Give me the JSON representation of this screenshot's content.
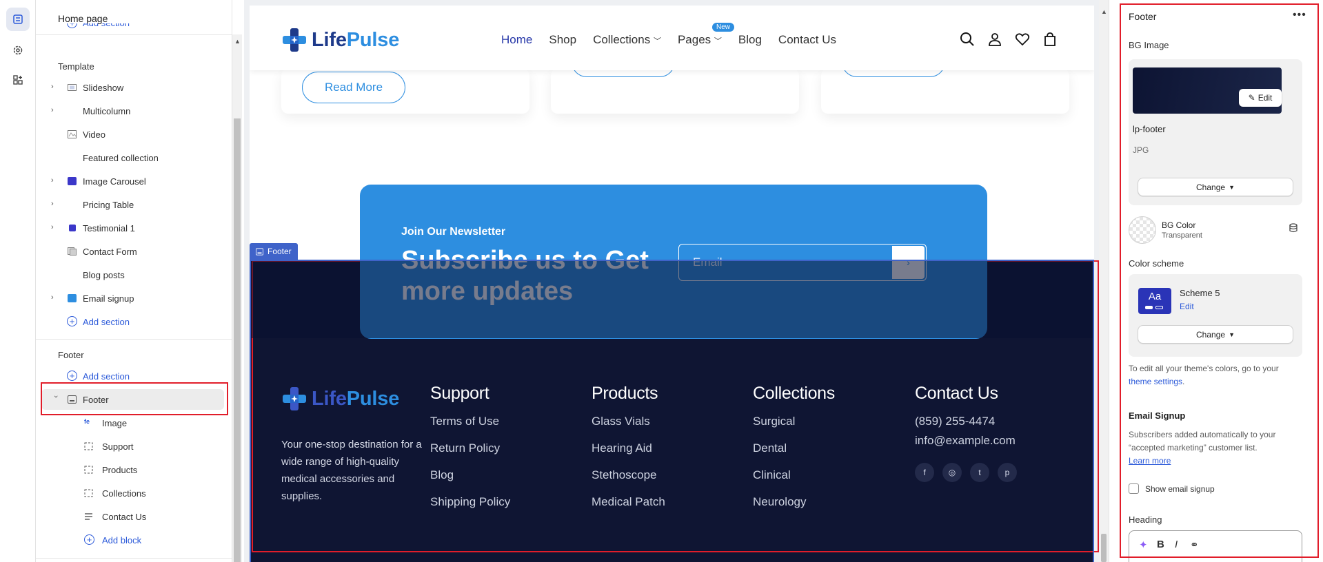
{
  "sidebar": {
    "title": "Home page",
    "template_label": "Template",
    "template_items": [
      {
        "label": "Slideshow"
      },
      {
        "label": "Multicolumn"
      },
      {
        "label": "Video"
      },
      {
        "label": "Featured collection"
      },
      {
        "label": "Image Carousel"
      },
      {
        "label": "Pricing Table"
      },
      {
        "label": "Testimonial 1"
      },
      {
        "label": "Contact Form"
      },
      {
        "label": "Blog posts"
      },
      {
        "label": "Email signup"
      }
    ],
    "add_section": "Add section",
    "footer_label": "Footer",
    "footer_item": "Footer",
    "footer_children": [
      {
        "label": "Image"
      },
      {
        "label": "Support"
      },
      {
        "label": "Products"
      },
      {
        "label": "Collections"
      },
      {
        "label": "Contact Us"
      }
    ],
    "add_block": "Add block"
  },
  "site": {
    "logo_life": "Life",
    "logo_pulse": "Pulse",
    "nav": [
      "Home",
      "Shop",
      "Collections",
      "Pages",
      "Blog",
      "Contact Us"
    ],
    "new_badge": "New",
    "read_more": "Read More",
    "newsletter_kicker": "Join Our Newsletter",
    "newsletter_title": "Subscribe us to Get more updates",
    "email_placeholder": "Email",
    "footer_tag": "Footer",
    "footer_desc": "Your one-stop destination for a wide range of high-quality medical accessories and supplies.",
    "columns": [
      {
        "title": "Support",
        "links": [
          "Terms of Use",
          "Return Policy",
          "Blog",
          "Shipping Policy"
        ]
      },
      {
        "title": "Products",
        "links": [
          "Glass Vials",
          "Hearing Aid",
          "Stethoscope",
          "Medical Patch"
        ]
      },
      {
        "title": "Collections",
        "links": [
          "Surgical",
          "Dental",
          "Clinical",
          "Neurology"
        ]
      }
    ],
    "contact": {
      "title": "Contact Us",
      "phone": "(859) 255-4474",
      "email": "info@example.com"
    },
    "social_icons": [
      "facebook-icon",
      "instagram-icon",
      "twitter-icon",
      "pinterest-icon"
    ]
  },
  "panel": {
    "title": "Footer",
    "bg_image_label": "BG Image",
    "edit_label": "Edit",
    "image_name": "lp-footer",
    "image_type": "JPG",
    "change_label": "Change",
    "bg_color_label": "BG Color",
    "bg_color_value": "Transparent",
    "color_scheme_label": "Color scheme",
    "scheme_name": "Scheme 5",
    "scheme_icon_text": "Aa",
    "scheme_edit": "Edit",
    "theme_note": "To edit all your theme's colors, go to your",
    "theme_link": "theme settings",
    "email_signup_heading": "Email Signup",
    "email_note": "Subscribers added automatically to your “accepted marketing” customer list.",
    "learn_more": "Learn more",
    "show_email_signup": "Show email signup",
    "heading_label": "Heading"
  },
  "colors": {
    "brand_dark": "#1e3a8a",
    "brand_blue": "#2d8ee0",
    "footer_bg": "#0f1533",
    "highlight_red": "#e11d2a",
    "link_blue": "#2c5ad9"
  }
}
